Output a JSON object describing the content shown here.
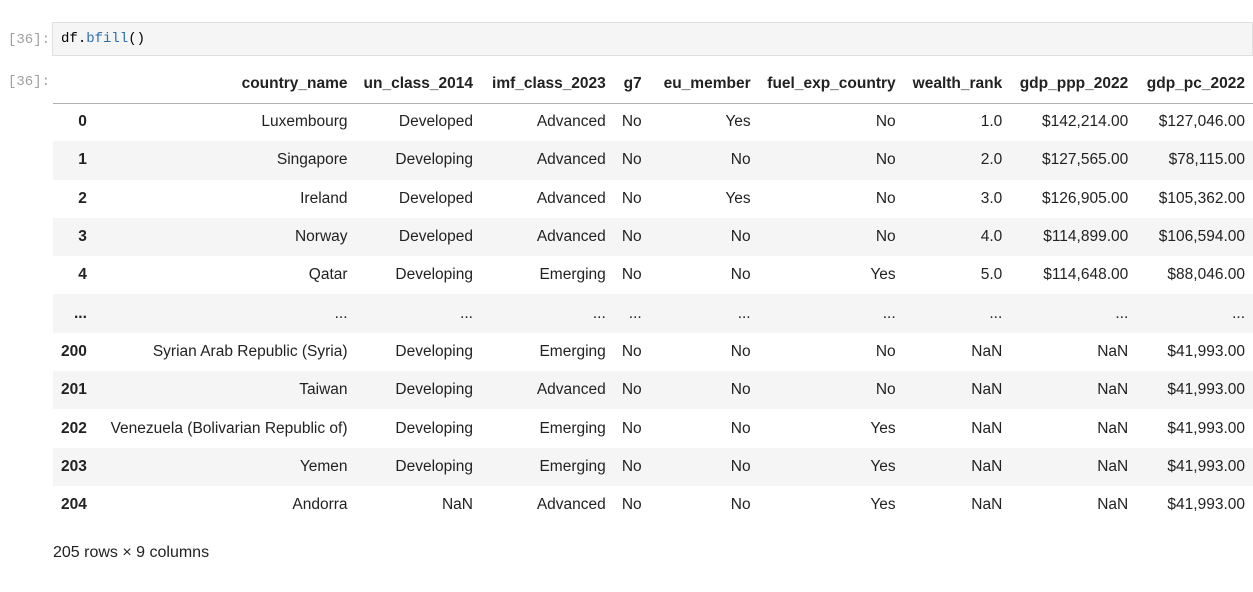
{
  "cell": {
    "in_prompt": "[36]:",
    "out_prompt": "[36]:",
    "code": {
      "var": "df",
      "dot": ".",
      "fn": "bfill",
      "parens": "()"
    }
  },
  "table": {
    "columns": [
      "country_name",
      "un_class_2014",
      "imf_class_2023",
      "g7",
      "eu_member",
      "fuel_exp_country",
      "wealth_rank",
      "gdp_ppp_2022",
      "gdp_pc_2022"
    ],
    "rows": [
      {
        "index": "0",
        "cells": [
          "Luxembourg",
          "Developed",
          "Advanced",
          "No",
          "Yes",
          "No",
          "1.0",
          "$142,214.00",
          "$127,046.00"
        ]
      },
      {
        "index": "1",
        "cells": [
          "Singapore",
          "Developing",
          "Advanced",
          "No",
          "No",
          "No",
          "2.0",
          "$127,565.00",
          "$78,115.00"
        ]
      },
      {
        "index": "2",
        "cells": [
          "Ireland",
          "Developed",
          "Advanced",
          "No",
          "Yes",
          "No",
          "3.0",
          "$126,905.00",
          "$105,362.00"
        ]
      },
      {
        "index": "3",
        "cells": [
          "Norway",
          "Developed",
          "Advanced",
          "No",
          "No",
          "No",
          "4.0",
          "$114,899.00",
          "$106,594.00"
        ]
      },
      {
        "index": "4",
        "cells": [
          "Qatar",
          "Developing",
          "Emerging",
          "No",
          "No",
          "Yes",
          "5.0",
          "$114,648.00",
          "$88,046.00"
        ]
      },
      {
        "index": "...",
        "cells": [
          "...",
          "...",
          "...",
          "...",
          "...",
          "...",
          "...",
          "...",
          "..."
        ]
      },
      {
        "index": "200",
        "cells": [
          "Syrian Arab Republic (Syria)",
          "Developing",
          "Emerging",
          "No",
          "No",
          "No",
          "NaN",
          "NaN",
          "$41,993.00"
        ]
      },
      {
        "index": "201",
        "cells": [
          "Taiwan",
          "Developing",
          "Advanced",
          "No",
          "No",
          "No",
          "NaN",
          "NaN",
          "$41,993.00"
        ]
      },
      {
        "index": "202",
        "cells": [
          "Venezuela (Bolivarian Republic of)",
          "Developing",
          "Emerging",
          "No",
          "No",
          "Yes",
          "NaN",
          "NaN",
          "$41,993.00"
        ]
      },
      {
        "index": "203",
        "cells": [
          "Yemen",
          "Developing",
          "Emerging",
          "No",
          "No",
          "Yes",
          "NaN",
          "NaN",
          "$41,993.00"
        ]
      },
      {
        "index": "204",
        "cells": [
          "Andorra",
          "NaN",
          "Advanced",
          "No",
          "No",
          "Yes",
          "NaN",
          "NaN",
          "$41,993.00"
        ]
      }
    ],
    "shape_label": "205 rows × 9 columns"
  }
}
